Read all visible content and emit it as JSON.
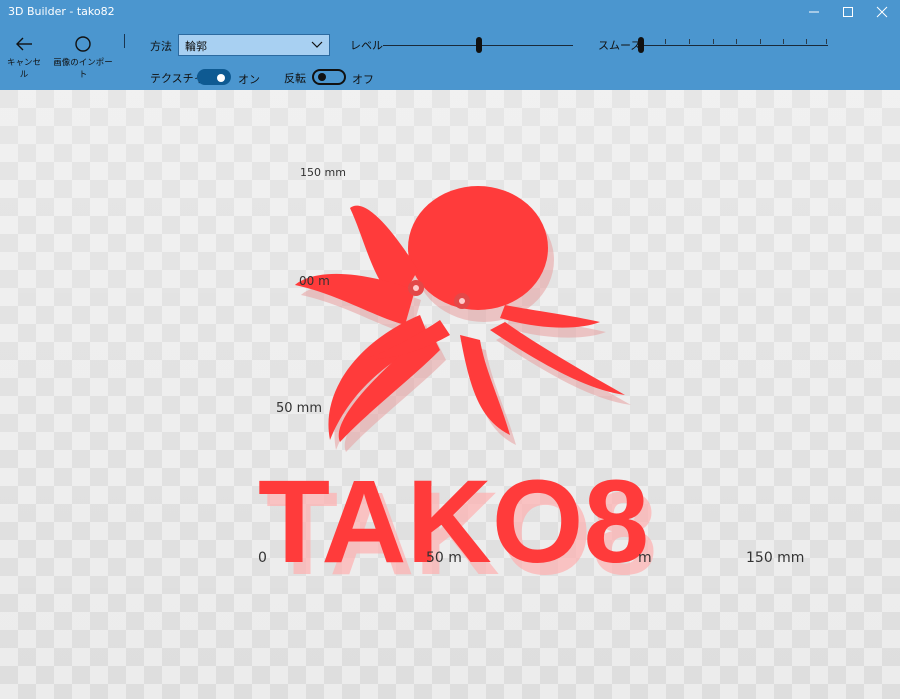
{
  "window": {
    "title": "3D Builder - tako82"
  },
  "toolbar": {
    "cancel_label": "キャンセル",
    "import_label": "画像のインポート",
    "method_label": "方法",
    "method_value": "輪郭",
    "level_label": "レベル",
    "level_value": 0.5,
    "smooth_label": "スムーズ",
    "smooth_value": 0.0,
    "texture_label": "テクスチャ",
    "texture_state": "オン",
    "invert_label": "反転",
    "invert_state": "オフ"
  },
  "viewport": {
    "model_text": "TAKO8",
    "model_color": "#ff3b3b",
    "axis_labels": {
      "y_top": "150 mm",
      "y_mid": "00 m",
      "y_low": "50 mm",
      "x_zero": "0",
      "x_mid": "50 m",
      "x_right_partial": "m",
      "x_far": "150 mm"
    }
  },
  "colors": {
    "accent": "#4b96cf",
    "toggle_on": "#0e5a92",
    "select_bg": "#a8d0f2"
  }
}
